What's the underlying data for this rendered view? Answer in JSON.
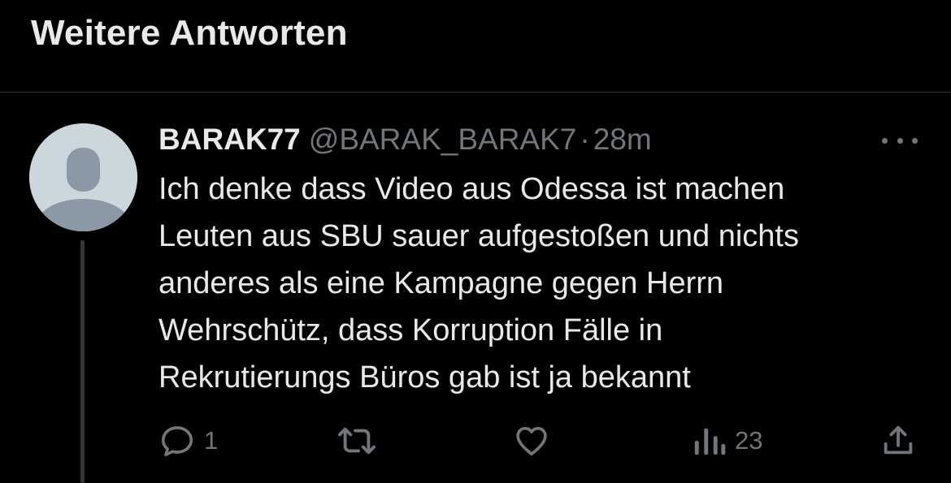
{
  "section": {
    "title": "Weitere Antworten"
  },
  "tweet": {
    "display_name": "BARAK77",
    "handle": "@BARAK_BARAK7",
    "separator": "·",
    "time": "28m",
    "text_lines": [
      "Ich denke dass Video aus Odessa ist machen",
      "Leuten aus SBU sauer aufgestoßen und nichts",
      "anderes als eine Kampagne gegen Herrn",
      "Wehrschütz, dass Korruption Fälle in",
      "Rekrutierungs Büros gab ist ja bekannt"
    ],
    "actions": {
      "reply": {
        "icon": "reply-icon",
        "count": "1"
      },
      "retweet": {
        "icon": "retweet-icon"
      },
      "like": {
        "icon": "heart-icon"
      },
      "views": {
        "icon": "views-icon",
        "count": "23"
      },
      "share": {
        "icon": "share-icon"
      }
    }
  },
  "colors": {
    "background": "#000000",
    "text_primary": "#e7e9ea",
    "text_secondary": "#71767b",
    "divider": "#2f3336",
    "avatar_bg": "#ccd6dd",
    "avatar_figure": "#8b98a5"
  }
}
